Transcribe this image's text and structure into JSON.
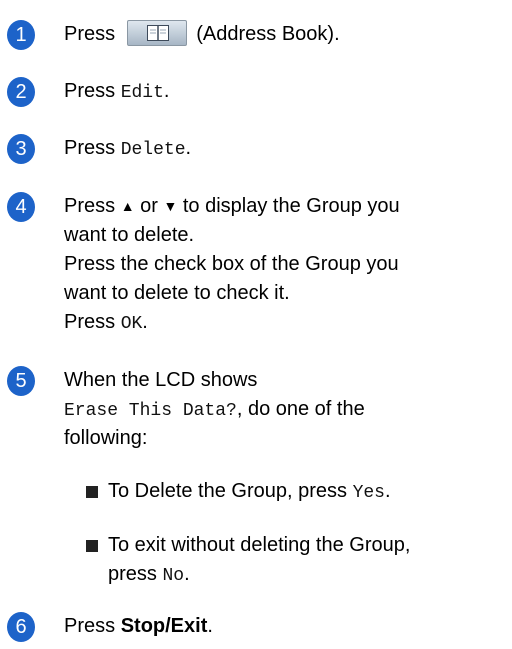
{
  "steps": [
    {
      "num": "1",
      "pre": "Press",
      "icon": "address-book-icon",
      "post": "(Address Book)."
    },
    {
      "num": "2",
      "pre": "Press ",
      "code": "Edit",
      "post": "."
    },
    {
      "num": "3",
      "pre": "Press ",
      "code": "Delete",
      "post": "."
    },
    {
      "num": "4",
      "line1_pre": "Press ",
      "up": "▲",
      "or": " or ",
      "down": "▼",
      "line1_post": " to display the Group you",
      "line2": "want to delete.",
      "line3": "Press the check box of the Group you",
      "line4": "want to delete to check it.",
      "line5_pre": "Press ",
      "line5_code": "OK",
      "line5_post": "."
    },
    {
      "num": "5",
      "line1": "When the LCD shows",
      "line2_code": "Erase This Data?",
      "line2_post": ", do one of the",
      "line3": "following:",
      "bullets": [
        {
          "pre": "To Delete the Group, press ",
          "code": "Yes",
          "post": "."
        },
        {
          "line1": "To exit without deleting the Group,",
          "pre": "press ",
          "code": "No",
          "post": "."
        }
      ]
    },
    {
      "num": "6",
      "pre": "Press ",
      "bold": "Stop/Exit",
      "post": "."
    }
  ],
  "colors": {
    "badge": "#1d63c9"
  }
}
